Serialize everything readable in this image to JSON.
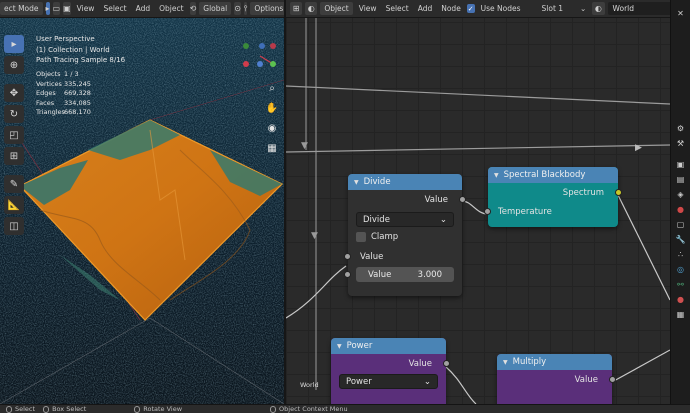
{
  "viewport": {
    "header": {
      "mode_label": "ect Mode",
      "menu_view": "View",
      "menu_select": "Select",
      "menu_add": "Add",
      "menu_object": "Object",
      "orientation": "Global",
      "options": "Options"
    },
    "info": {
      "perspective": "User Perspective",
      "collection": "(1) Collection | World",
      "sample": "Path Tracing Sample 8/16"
    },
    "stats": [
      {
        "label": "Objects",
        "value": "1 / 3"
      },
      {
        "label": "Vertices",
        "value": "335,245"
      },
      {
        "label": "Edges",
        "value": "669,328"
      },
      {
        "label": "Faces",
        "value": "334,085"
      },
      {
        "label": "Triangles",
        "value": "668,170"
      }
    ],
    "tools": [
      "select-box-icon",
      "cursor-icon",
      "move-icon",
      "rotate-icon",
      "scale-icon",
      "transform-icon",
      "annotate-icon",
      "measure-icon",
      "add-cube-icon"
    ]
  },
  "node_editor": {
    "header": {
      "editor_type": "Object",
      "menu_view": "View",
      "menu_select": "Select",
      "menu_add": "Add",
      "menu_node": "Node",
      "use_nodes_label": "Use Nodes",
      "slot": "Slot 1",
      "world": "World"
    },
    "world_label": "World",
    "nodes": {
      "divide": {
        "title": "Divide",
        "output": "Value",
        "operation": "Divide",
        "clamp_label": "Clamp",
        "input_label": "Value",
        "field_label": "Value",
        "field_value": "3.000",
        "color": "#4a84b5"
      },
      "spectral": {
        "title": "Spectral Blackbody",
        "output": "Spectrum",
        "input": "Temperature",
        "color": "#4a84b5",
        "body_color": "#0f8a8a"
      },
      "power": {
        "title": "Power",
        "output": "Value",
        "operation": "Power",
        "color": "#4a84b5",
        "body_color": "#5a2f7a"
      },
      "multiply": {
        "title": "Multiply",
        "output": "Value",
        "color": "#4a84b5",
        "body_color": "#5a2f7a"
      }
    }
  },
  "statusbar": {
    "select": "Select",
    "box_select": "Box Select",
    "rotate_view": "Rotate View",
    "context_menu": "Object Context Menu"
  }
}
